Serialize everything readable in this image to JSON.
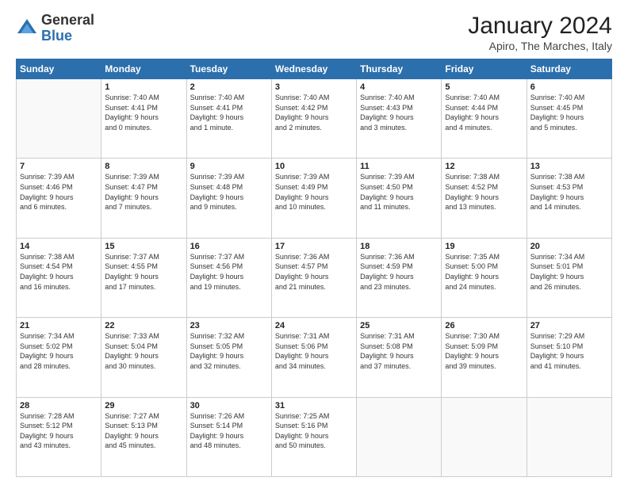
{
  "logo": {
    "general": "General",
    "blue": "Blue"
  },
  "header": {
    "month_year": "January 2024",
    "location": "Apiro, The Marches, Italy"
  },
  "days_of_week": [
    "Sunday",
    "Monday",
    "Tuesday",
    "Wednesday",
    "Thursday",
    "Friday",
    "Saturday"
  ],
  "weeks": [
    [
      {
        "day": "",
        "info": ""
      },
      {
        "day": "1",
        "info": "Sunrise: 7:40 AM\nSunset: 4:41 PM\nDaylight: 9 hours\nand 0 minutes."
      },
      {
        "day": "2",
        "info": "Sunrise: 7:40 AM\nSunset: 4:41 PM\nDaylight: 9 hours\nand 1 minute."
      },
      {
        "day": "3",
        "info": "Sunrise: 7:40 AM\nSunset: 4:42 PM\nDaylight: 9 hours\nand 2 minutes."
      },
      {
        "day": "4",
        "info": "Sunrise: 7:40 AM\nSunset: 4:43 PM\nDaylight: 9 hours\nand 3 minutes."
      },
      {
        "day": "5",
        "info": "Sunrise: 7:40 AM\nSunset: 4:44 PM\nDaylight: 9 hours\nand 4 minutes."
      },
      {
        "day": "6",
        "info": "Sunrise: 7:40 AM\nSunset: 4:45 PM\nDaylight: 9 hours\nand 5 minutes."
      }
    ],
    [
      {
        "day": "7",
        "info": "Sunrise: 7:39 AM\nSunset: 4:46 PM\nDaylight: 9 hours\nand 6 minutes."
      },
      {
        "day": "8",
        "info": "Sunrise: 7:39 AM\nSunset: 4:47 PM\nDaylight: 9 hours\nand 7 minutes."
      },
      {
        "day": "9",
        "info": "Sunrise: 7:39 AM\nSunset: 4:48 PM\nDaylight: 9 hours\nand 9 minutes."
      },
      {
        "day": "10",
        "info": "Sunrise: 7:39 AM\nSunset: 4:49 PM\nDaylight: 9 hours\nand 10 minutes."
      },
      {
        "day": "11",
        "info": "Sunrise: 7:39 AM\nSunset: 4:50 PM\nDaylight: 9 hours\nand 11 minutes."
      },
      {
        "day": "12",
        "info": "Sunrise: 7:38 AM\nSunset: 4:52 PM\nDaylight: 9 hours\nand 13 minutes."
      },
      {
        "day": "13",
        "info": "Sunrise: 7:38 AM\nSunset: 4:53 PM\nDaylight: 9 hours\nand 14 minutes."
      }
    ],
    [
      {
        "day": "14",
        "info": "Sunrise: 7:38 AM\nSunset: 4:54 PM\nDaylight: 9 hours\nand 16 minutes."
      },
      {
        "day": "15",
        "info": "Sunrise: 7:37 AM\nSunset: 4:55 PM\nDaylight: 9 hours\nand 17 minutes."
      },
      {
        "day": "16",
        "info": "Sunrise: 7:37 AM\nSunset: 4:56 PM\nDaylight: 9 hours\nand 19 minutes."
      },
      {
        "day": "17",
        "info": "Sunrise: 7:36 AM\nSunset: 4:57 PM\nDaylight: 9 hours\nand 21 minutes."
      },
      {
        "day": "18",
        "info": "Sunrise: 7:36 AM\nSunset: 4:59 PM\nDaylight: 9 hours\nand 23 minutes."
      },
      {
        "day": "19",
        "info": "Sunrise: 7:35 AM\nSunset: 5:00 PM\nDaylight: 9 hours\nand 24 minutes."
      },
      {
        "day": "20",
        "info": "Sunrise: 7:34 AM\nSunset: 5:01 PM\nDaylight: 9 hours\nand 26 minutes."
      }
    ],
    [
      {
        "day": "21",
        "info": "Sunrise: 7:34 AM\nSunset: 5:02 PM\nDaylight: 9 hours\nand 28 minutes."
      },
      {
        "day": "22",
        "info": "Sunrise: 7:33 AM\nSunset: 5:04 PM\nDaylight: 9 hours\nand 30 minutes."
      },
      {
        "day": "23",
        "info": "Sunrise: 7:32 AM\nSunset: 5:05 PM\nDaylight: 9 hours\nand 32 minutes."
      },
      {
        "day": "24",
        "info": "Sunrise: 7:31 AM\nSunset: 5:06 PM\nDaylight: 9 hours\nand 34 minutes."
      },
      {
        "day": "25",
        "info": "Sunrise: 7:31 AM\nSunset: 5:08 PM\nDaylight: 9 hours\nand 37 minutes."
      },
      {
        "day": "26",
        "info": "Sunrise: 7:30 AM\nSunset: 5:09 PM\nDaylight: 9 hours\nand 39 minutes."
      },
      {
        "day": "27",
        "info": "Sunrise: 7:29 AM\nSunset: 5:10 PM\nDaylight: 9 hours\nand 41 minutes."
      }
    ],
    [
      {
        "day": "28",
        "info": "Sunrise: 7:28 AM\nSunset: 5:12 PM\nDaylight: 9 hours\nand 43 minutes."
      },
      {
        "day": "29",
        "info": "Sunrise: 7:27 AM\nSunset: 5:13 PM\nDaylight: 9 hours\nand 45 minutes."
      },
      {
        "day": "30",
        "info": "Sunrise: 7:26 AM\nSunset: 5:14 PM\nDaylight: 9 hours\nand 48 minutes."
      },
      {
        "day": "31",
        "info": "Sunrise: 7:25 AM\nSunset: 5:16 PM\nDaylight: 9 hours\nand 50 minutes."
      },
      {
        "day": "",
        "info": ""
      },
      {
        "day": "",
        "info": ""
      },
      {
        "day": "",
        "info": ""
      }
    ]
  ]
}
